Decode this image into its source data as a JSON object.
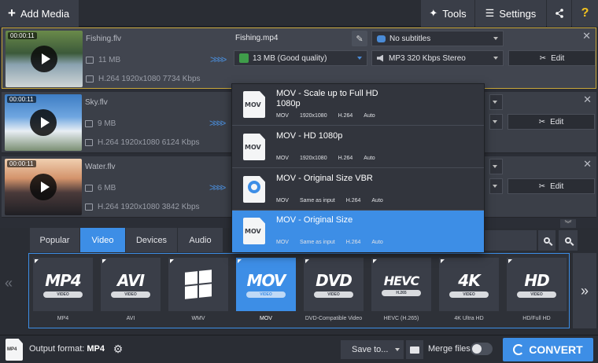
{
  "toolbar": {
    "add_media": "Add Media",
    "tools": "Tools",
    "settings": "Settings",
    "help": "?"
  },
  "files": [
    {
      "duration": "00:00:11",
      "name": "Fishing.flv",
      "size": "11 MB",
      "info": "H.264 1920x1080 7734 Kbps",
      "output_name": "Fishing.mp4",
      "quality": "13 MB (Good quality)",
      "subtitles": "No subtitles",
      "audio": "MP3 320 Kbps Stereo",
      "edit": "Edit"
    },
    {
      "duration": "00:00:11",
      "name": "Sky.flv",
      "size": "9 MB",
      "info": "H.264 1920x1080 6124 Kbps",
      "edit": "Edit"
    },
    {
      "duration": "00:00:11",
      "name": "Water.flv",
      "size": "6 MB",
      "info": "H.264 1920x1080 3842 Kbps",
      "edit": "Edit"
    }
  ],
  "presets": [
    {
      "title": "MOV - Scale up to Full HD 1080p",
      "details": [
        "MOV",
        "1920x1080",
        "H.264",
        "Auto"
      ],
      "icon": "MOV"
    },
    {
      "title": "MOV - HD 1080p",
      "details": [
        "MOV",
        "1920x1080",
        "H.264",
        "Auto"
      ],
      "icon": "MOV"
    },
    {
      "title": "MOV - Original Size VBR",
      "details": [
        "MOV",
        "Same as input",
        "H.264",
        "Auto"
      ],
      "icon": "quicktime"
    },
    {
      "title": "MOV - Original Size",
      "details": [
        "MOV",
        "Same as input",
        "H.264",
        "Auto"
      ],
      "icon": "MOV",
      "selected": true
    }
  ],
  "tabs": [
    "Popular",
    "Video",
    "Devices",
    "Audio"
  ],
  "active_tab": "Video",
  "formats": [
    {
      "big": "MP4",
      "sub": "VIDEO",
      "caption": "MP4"
    },
    {
      "big": "AVI",
      "sub": "VIDEO",
      "caption": "AVI"
    },
    {
      "big": "",
      "sub": "",
      "caption": "WMV"
    },
    {
      "big": "MOV",
      "sub": "VIDEO",
      "caption": "MOV",
      "active": true
    },
    {
      "big": "DVD",
      "sub": "VIDEO",
      "caption": "DVD-Compatible Video"
    },
    {
      "big": "HEVC",
      "sub": "H.265",
      "caption": "HEVC (H.265)"
    },
    {
      "big": "4K",
      "sub": "VIDEO",
      "caption": "4K Ultra HD"
    },
    {
      "big": "HD",
      "sub": "VIDEO",
      "caption": "HD/Full HD"
    }
  ],
  "bottom": {
    "output_label": "Output format:",
    "output_value": "MP4",
    "output_icon": "MP4",
    "save_to": "Save to...",
    "merge_files": "Merge files:",
    "convert": "CONVERT"
  },
  "colors": {
    "accent": "#3d8ee6",
    "selection_border": "#c8a73a",
    "help": "#f3c31f"
  }
}
